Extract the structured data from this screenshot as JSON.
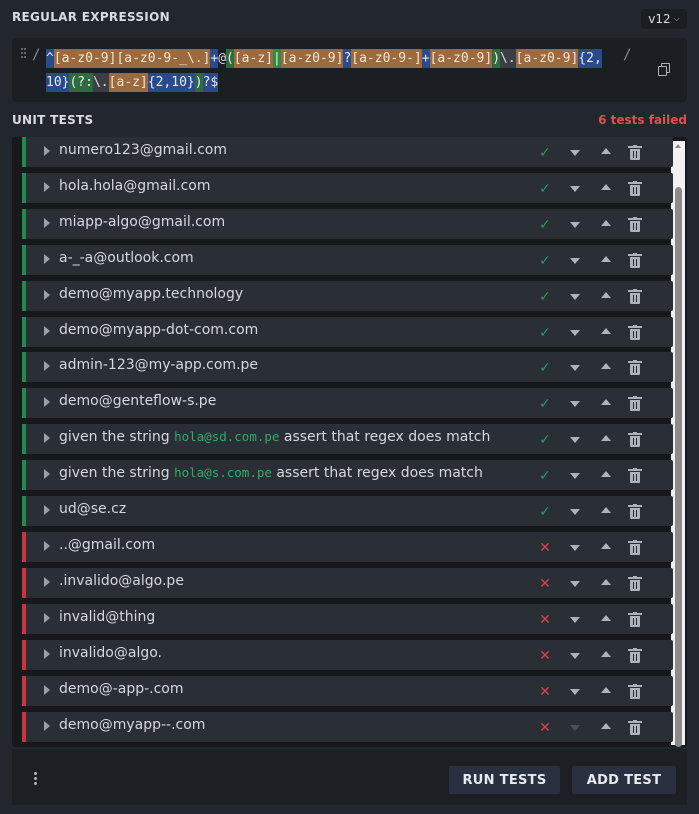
{
  "header": {
    "title": "REGULAR EXPRESSION",
    "version": "v12"
  },
  "regex": {
    "delimiter_open": "/",
    "delimiter_close": "/",
    "tokens": [
      {
        "t": "^",
        "bg": "#2a4a8c",
        "fg": "#e6eaf2"
      },
      {
        "t": "[a-z0-9]",
        "bg": "#9b6a3e",
        "fg": "#f2e6d6"
      },
      {
        "t": "[a-z0-9-_\\.]",
        "bg": "#9b6a3e",
        "fg": "#f2e6d6"
      },
      {
        "t": "+",
        "bg": "#2a4a8c",
        "fg": "#e6eaf2"
      },
      {
        "t": "@",
        "bg": "",
        "fg": "#d9dce1"
      },
      {
        "t": "(",
        "bg": "#2f6b3f",
        "fg": "#e6efe8"
      },
      {
        "t": "[a-z]",
        "bg": "#9b6a3e",
        "fg": "#f2e6d6"
      },
      {
        "t": "|",
        "bg": "#2f8a3f",
        "fg": "#e6efe8"
      },
      {
        "t": "[a-z0-9]",
        "bg": "#9b6a3e",
        "fg": "#f2e6d6"
      },
      {
        "t": "?",
        "bg": "#2a4a8c",
        "fg": "#e6eaf2"
      },
      {
        "t": "[a-z0-9-]",
        "bg": "#9b6a3e",
        "fg": "#f2e6d6"
      },
      {
        "t": "+",
        "bg": "#2a4a8c",
        "fg": "#e6eaf2"
      },
      {
        "t": "[a-z0-9]",
        "bg": "#9b6a3e",
        "fg": "#f2e6d6"
      },
      {
        "t": ")",
        "bg": "#2f6b3f",
        "fg": "#e6efe8"
      },
      {
        "t": "\\.",
        "bg": "#3a3e45",
        "fg": "#d9dce1"
      },
      {
        "t": "[a-z0-9]",
        "bg": "#9b6a3e",
        "fg": "#f2e6d6"
      },
      {
        "t": "{2,10}",
        "bg": "#2a4a8c",
        "fg": "#e6eaf2"
      },
      {
        "t": "(?:",
        "bg": "#2f6b3f",
        "fg": "#e6efe8"
      },
      {
        "t": "\\.",
        "bg": "#3a3e45",
        "fg": "#d9dce1"
      },
      {
        "t": "[a-z]",
        "bg": "#9b6a3e",
        "fg": "#f2e6d6"
      },
      {
        "t": "{2,10}",
        "bg": "#2a4a8c",
        "fg": "#e6eaf2"
      },
      {
        "t": ")",
        "bg": "#2f6b3f",
        "fg": "#e6efe8"
      },
      {
        "t": "?",
        "bg": "#2a4a8c",
        "fg": "#e6eaf2"
      },
      {
        "t": "$",
        "bg": "#2a4a8c",
        "fg": "#e6eaf2"
      }
    ]
  },
  "unit_tests": {
    "title": "UNIT TESTS",
    "failed_text": "6 tests failed",
    "tests": [
      {
        "label": "numero123@gmail.com",
        "status": "pass"
      },
      {
        "label": "hola.hola@gmail.com",
        "status": "pass"
      },
      {
        "label": "miapp-algo@gmail.com",
        "status": "pass"
      },
      {
        "label": "a-_-a@outlook.com",
        "status": "pass"
      },
      {
        "label": "demo@myapp.technology",
        "status": "pass"
      },
      {
        "label": "demo@myapp-dot-com.com",
        "status": "pass"
      },
      {
        "label": "admin-123@my-app.com.pe",
        "status": "pass"
      },
      {
        "label": "demo@genteflow-s.pe",
        "status": "pass"
      },
      {
        "prefix": "given the string ",
        "code": "hola@sd.com.pe",
        "suffix": " assert that regex does match",
        "status": "pass"
      },
      {
        "prefix": "given the string ",
        "code": "hola@s.com.pe",
        "suffix": " assert that regex does match",
        "status": "pass"
      },
      {
        "label": "ud@se.cz",
        "status": "pass"
      },
      {
        "label": "..@gmail.com",
        "status": "fail"
      },
      {
        "label": ".invalido@algo.pe",
        "status": "fail"
      },
      {
        "label": "invalid@thing",
        "status": "fail"
      },
      {
        "label": "invalido@algo.",
        "status": "fail"
      },
      {
        "label": "demo@-app-.com",
        "status": "fail"
      },
      {
        "label": "demo@myapp--.com",
        "status": "fail"
      }
    ]
  },
  "footer": {
    "run_label": "RUN TESTS",
    "add_label": "ADD TEST"
  },
  "icons": {
    "pass": "✓",
    "fail": "✕"
  }
}
